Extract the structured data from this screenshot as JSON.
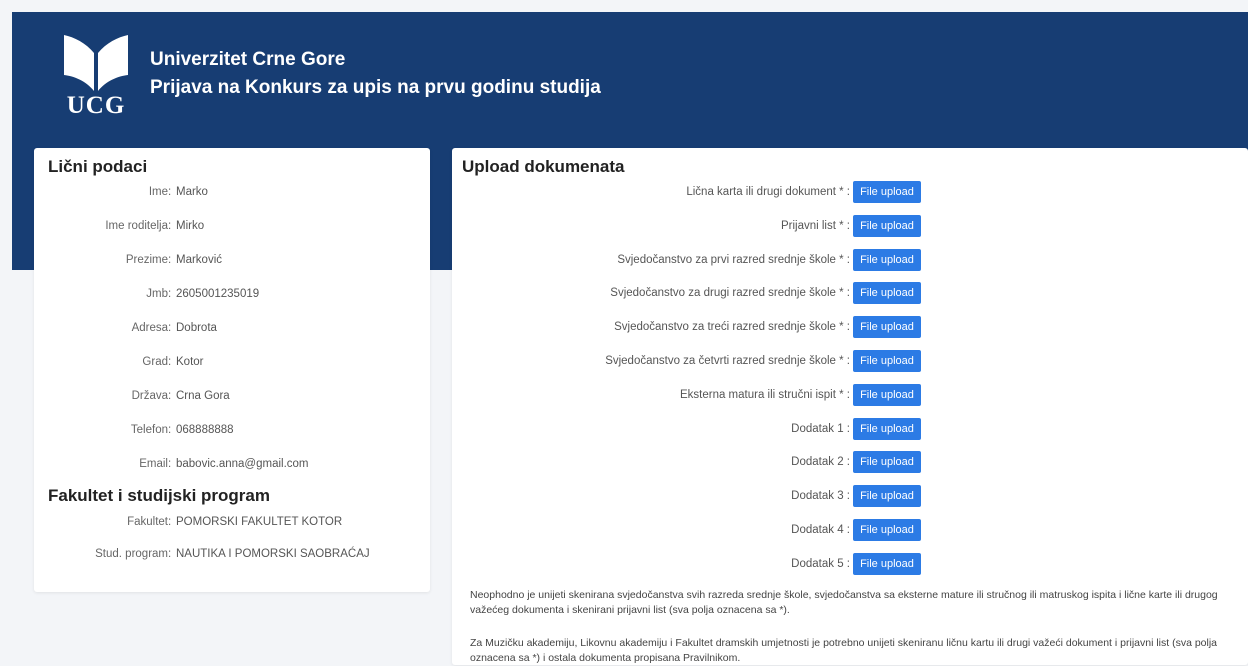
{
  "header": {
    "logo_text": "UCG",
    "title_line1": "Univerzitet Crne Gore",
    "title_line2": "Prijava na Konkurs za upis na prvu godinu studija"
  },
  "personal": {
    "title": "Lični podaci",
    "fields": [
      {
        "label": "Ime",
        "value": "Marko"
      },
      {
        "label": "Ime roditelja",
        "value": "Mirko"
      },
      {
        "label": "Prezime",
        "value": "Marković"
      },
      {
        "label": "Jmb",
        "value": "2605001235019"
      },
      {
        "label": "Adresa",
        "value": "Dobrota"
      },
      {
        "label": "Grad",
        "value": "Kotor"
      },
      {
        "label": "Država",
        "value": "Crna Gora"
      },
      {
        "label": "Telefon",
        "value": "068888888"
      },
      {
        "label": "Email",
        "value": "babovic.anna@gmail.com"
      }
    ]
  },
  "faculty": {
    "title": "Fakultet i studijski program",
    "fields": [
      {
        "label": "Fakultet",
        "value": "POMORSKI FAKULTET KOTOR"
      },
      {
        "label": "Stud. program",
        "value": "NAUTIKA I POMORSKI SAOBRAĆAJ"
      }
    ]
  },
  "upload": {
    "title": "Upload dokumenata",
    "button_label": "File upload",
    "items": [
      "Lična karta ili drugi dokument * :",
      "Prijavni list * :",
      "Svjedočanstvo za prvi razred srednje škole * :",
      "Svjedočanstvo za drugi razred srednje škole * :",
      "Svjedočanstvo za treći razred srednje škole * :",
      "Svjedočanstvo za četvrti razred srednje škole * :",
      "Eksterna matura ili stručni ispit * :",
      "Dodatak 1 :",
      "Dodatak 2 :",
      "Dodatak 3 :",
      "Dodatak 4 :",
      "Dodatak 5 :"
    ],
    "note1": "Neophodno je unijeti skenirana svjedočanstva svih razreda srednje škole, svjedočanstva sa eksterne mature ili stručnog ili matruskog ispita i lične karte ili drugog važećeg dokumenta i skenirani prijavni list (sva polja oznacena sa *).",
    "note2": "Za Muzičku akademiju, Likovnu akademiju i Fakultet dramskih umjetnosti je potrebno unijeti skeniranu ličnu kartu ili drugi važeći dokument i prijavni list (sva polja oznacena sa *) i ostala dokumenta propisana Pravilnikom."
  },
  "colors": {
    "header_bg": "#173d73",
    "button_bg": "#2c7be5",
    "page_bg": "#f3f5f8"
  }
}
